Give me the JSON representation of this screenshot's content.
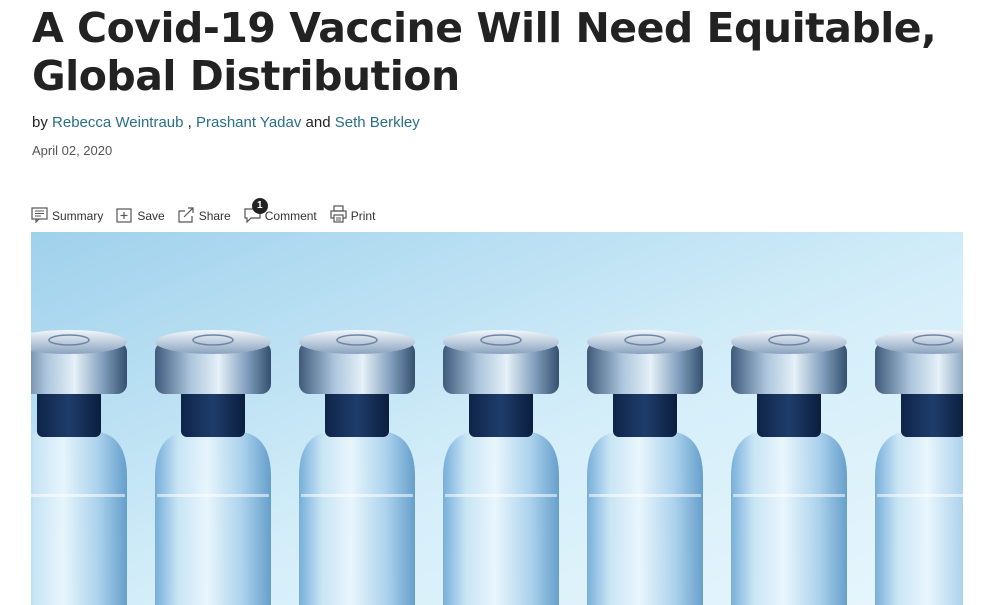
{
  "article": {
    "title_line1": "A Covid-19 Vaccine Will Need Equitable,",
    "title_line2": "Global Distribution",
    "byline": {
      "prefix": "by",
      "authors": [
        "Rebecca Weintraub",
        "Prashant Yadav",
        "Seth Berkley"
      ],
      "separator": ",",
      "conjunction": "and"
    },
    "date": "April 02, 2020"
  },
  "toolbar": {
    "summary": {
      "label": "Summary",
      "icon": "summary-icon"
    },
    "save": {
      "label": "Save",
      "icon": "save-icon"
    },
    "share": {
      "label": "Share",
      "icon": "share-icon"
    },
    "comment": {
      "label": "Comment",
      "icon": "comment-icon",
      "count": "1"
    },
    "print": {
      "label": "Print",
      "icon": "print-icon"
    }
  },
  "hero_image": {
    "subject": "row of glass vaccine vials with metal caps",
    "background_color": "#c9e7f6",
    "vial_count": 7
  },
  "colors": {
    "link": "#2a6f8a",
    "text": "#222222",
    "badge": "#222222"
  }
}
